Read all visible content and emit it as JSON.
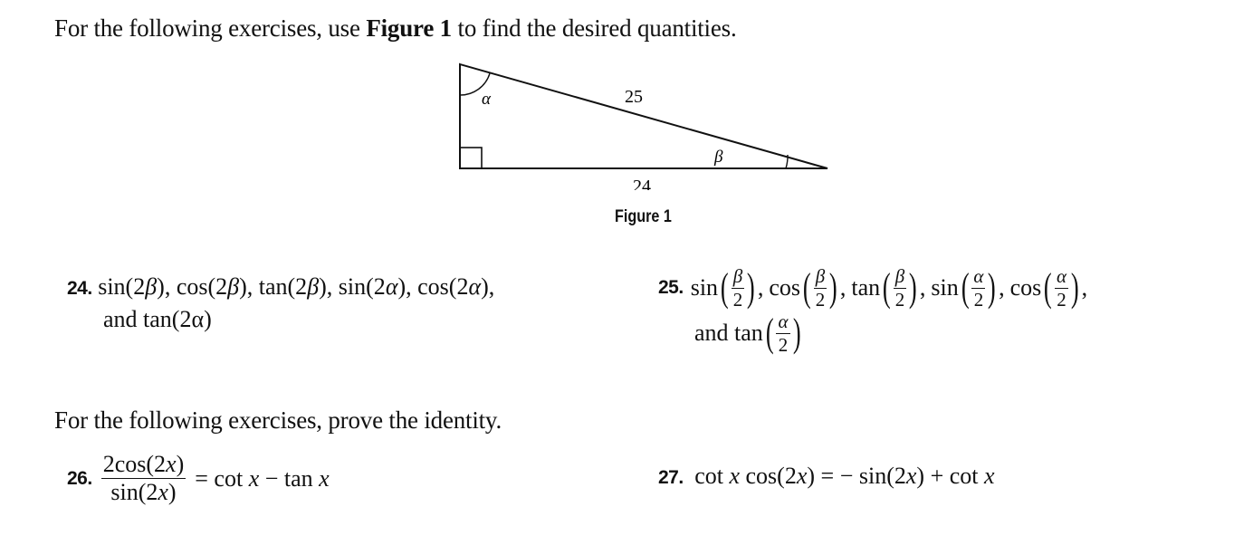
{
  "section1": {
    "intro_prefix": "For the following exercises, use ",
    "intro_bold": "Figure 1",
    "intro_suffix": " to find the desired quantities."
  },
  "figure": {
    "caption": "Figure 1",
    "hypotenuse_label": "25",
    "base_label": "24",
    "angle_top": "α",
    "angle_right": "β"
  },
  "exercises": {
    "ex24": {
      "number": "24.",
      "line1": "sin(2β), cos(2β), tan(2β), sin(2α), cos(2α),",
      "line2": "and tan(2α)"
    },
    "ex25": {
      "number": "25.",
      "items": [
        {
          "fn": "sin",
          "num": "β",
          "den": "2",
          "sep": ","
        },
        {
          "fn": "cos",
          "num": "β",
          "den": "2",
          "sep": ","
        },
        {
          "fn": "tan",
          "num": "β",
          "den": "2",
          "sep": ","
        },
        {
          "fn": "sin",
          "num": "α",
          "den": "2",
          "sep": ","
        },
        {
          "fn": "cos",
          "num": "α",
          "den": "2",
          "sep": ","
        }
      ],
      "last_prefix": "and tan",
      "last_num": "α",
      "last_den": "2"
    },
    "section2_intro": "For the following exercises, prove the identity.",
    "ex26": {
      "number": "26.",
      "frac_num": "2cos(2x)",
      "frac_den": "sin(2x)",
      "rhs": "= cot x − tan x"
    },
    "ex27": {
      "number": "27.",
      "expression": "cot x cos(2x) = − sin(2x) + cot x"
    }
  }
}
